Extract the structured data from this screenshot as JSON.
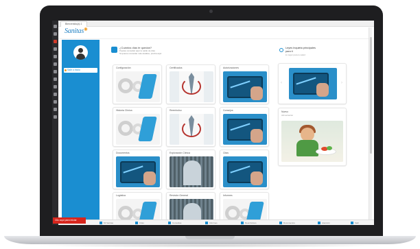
{
  "browser": {
    "tab_title": "Bienvenido(a) 1"
  },
  "brand": {
    "logo_text": "Sanitas",
    "accent_color": "#1a8ed1",
    "logo_mark_color": "#f29a1f",
    "os_start_label": "Clic aquí para iniciar"
  },
  "sidebar": {
    "avatar_icon": "user-avatar-icon",
    "nav_item_label": "Salir o inicio"
  },
  "help": {
    "question": "¿Cuántos días te quedan?",
    "line1": "Puedes consultar aquí tu saldo de días",
    "line2": "Si quieres consultar más detalles, pincha aquí"
  },
  "tiles": [
    {
      "title": "Configuración",
      "image": "gear"
    },
    {
      "title": "Certificados",
      "image": "doctor"
    },
    {
      "title": "Autorizaciones",
      "image": "tablet"
    },
    {
      "title": "Historia Clínica",
      "image": "gear"
    },
    {
      "title": "Reembolso",
      "image": "doctor"
    },
    {
      "title": "Consejos",
      "image": "tablet"
    },
    {
      "title": "Documentos",
      "image": "tablet"
    },
    {
      "title": "Exploración Clínica",
      "image": "ecg"
    },
    {
      "title": "Citas",
      "image": "tablet"
    },
    {
      "title": "Logística",
      "image": "gear"
    },
    {
      "title": "Revisión General",
      "image": "ecg"
    },
    {
      "title": "Informes",
      "image": "gear"
    }
  ],
  "promo": {
    "title_line1": "Leyes Inquieta principales",
    "title_line2": "para ti",
    "subtitle": "lo mejor para tu salud",
    "news_tag": "Nuevo",
    "news_sub": "Alimentación"
  },
  "taskbar": {
    "items": [
      "Mi Sanitas",
      "Citas",
      "Consultas",
      "Informes",
      "Reembolsos",
      "Documentos",
      "Atención",
      "Salir"
    ]
  }
}
